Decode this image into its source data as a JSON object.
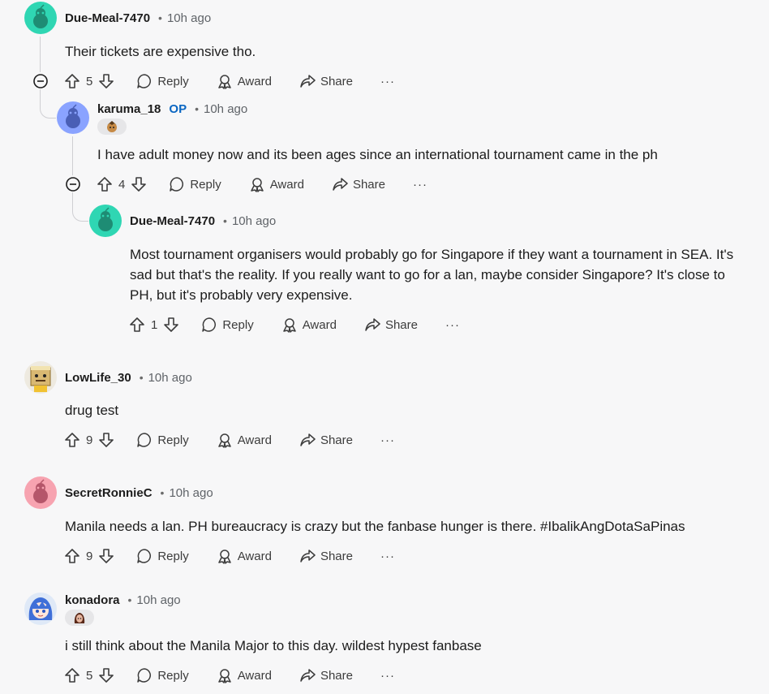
{
  "colors": {
    "accent_op": "#0a66c2",
    "avatar_teal": "#2fd6b3",
    "avatar_blue": "#8aa3ff",
    "avatar_pink": "#f7a3b0"
  },
  "comments": [
    {
      "author": "Due-Meal-7470",
      "time": "10h ago",
      "body": "Their tickets are expensive tho.",
      "votes": "5",
      "avatar": "snoo-teal"
    },
    {
      "author": "karuma_18",
      "op_label": "OP",
      "time": "10h ago",
      "body": "I have adult money now and its been ages since an international tournament came in the ph",
      "votes": "4",
      "avatar": "snoo-blue",
      "flair": "hero-face-flair"
    },
    {
      "author": "Due-Meal-7470",
      "time": "10h ago",
      "body_lines": [
        "Most tournament organisers would probably go for Singapore if they want a tournament in SEA. It's",
        "sad but that's the reality. If you really want to go for a lan, maybe consider Singapore? It's close to",
        "PH, but it's probably very expensive."
      ],
      "votes": "1",
      "avatar": "snoo-teal"
    },
    {
      "author": "LowLife_30",
      "time": "10h ago",
      "body": "drug test",
      "votes": "9",
      "avatar": "box-character"
    },
    {
      "author": "SecretRonnieC",
      "time": "10h ago",
      "body": "Manila needs a lan. PH bureaucracy is crazy but the fanbase hunger is there. #IbalikAngDotaSaPinas",
      "votes": "9",
      "avatar": "snoo-pink"
    },
    {
      "author": "konadora",
      "time": "10h ago",
      "body": "i still think about the Manila Major to this day. wildest hypest fanbase",
      "votes": "5",
      "avatar": "anime-girl",
      "flair": "hero-face-flair"
    }
  ],
  "actions": {
    "reply": "Reply",
    "award": "Award",
    "share": "Share",
    "more": "···"
  }
}
